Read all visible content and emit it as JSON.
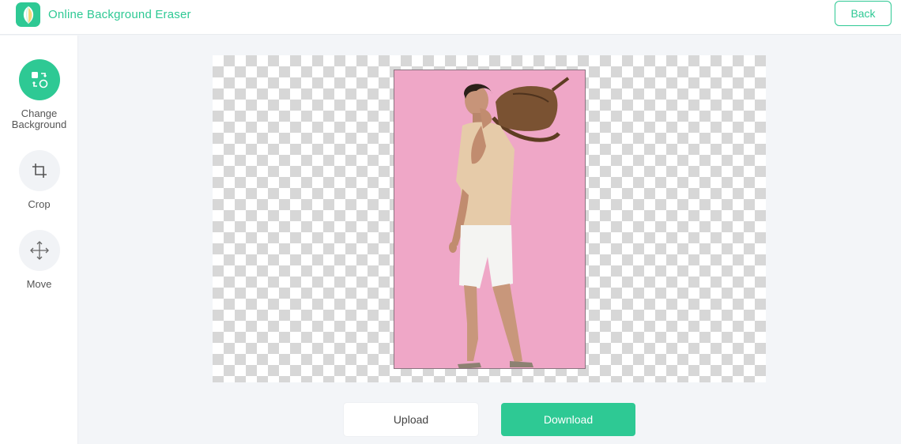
{
  "app": {
    "title": "Online Background Eraser",
    "logo_icon": "leaf-logo-icon"
  },
  "header": {
    "back_label": "Back"
  },
  "sidebar": {
    "tools": [
      {
        "label": "Change Background",
        "icon": "change-background-icon",
        "active": true
      },
      {
        "label": "Crop",
        "icon": "crop-icon",
        "active": false
      },
      {
        "label": "Move",
        "icon": "move-icon",
        "active": false
      }
    ]
  },
  "canvas": {
    "photo_background_color": "#efa7c7"
  },
  "actions": {
    "upload_label": "Upload",
    "download_label": "Download"
  },
  "colors": {
    "accent": "#2ec994"
  }
}
